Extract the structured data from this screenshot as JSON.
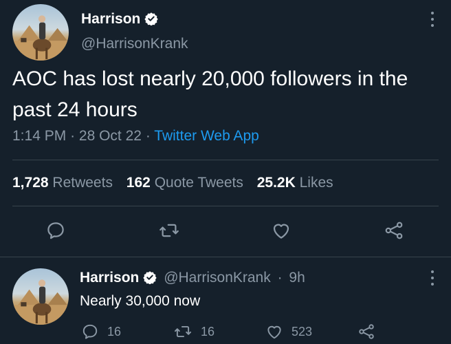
{
  "main_tweet": {
    "author_name": "Harrison",
    "author_handle": "@HarrisonKrank",
    "text": "AOC has lost nearly 20,000 followers in the past 24 hours",
    "time": "1:14 PM",
    "date": "28 Oct 22",
    "source": "Twitter Web App",
    "separator": "·",
    "stats": {
      "retweets_count": "1,728",
      "retweets_label": "Retweets",
      "quotes_count": "162",
      "quotes_label": "Quote Tweets",
      "likes_count": "25.2K",
      "likes_label": "Likes"
    }
  },
  "reply_tweet": {
    "author_name": "Harrison",
    "author_handle": "@HarrisonKrank",
    "separator": "·",
    "age": "9h",
    "text": "Nearly 30,000 now",
    "reply_count": "16",
    "retweet_count": "16",
    "like_count": "523"
  },
  "colors": {
    "background": "#15202b",
    "secondary_text": "#8b98a5",
    "accent": "#1d9bf0",
    "divider": "#38444d"
  },
  "icons": [
    "verified-badge-icon",
    "more-icon",
    "reply-icon",
    "retweet-icon",
    "like-icon",
    "share-icon"
  ]
}
